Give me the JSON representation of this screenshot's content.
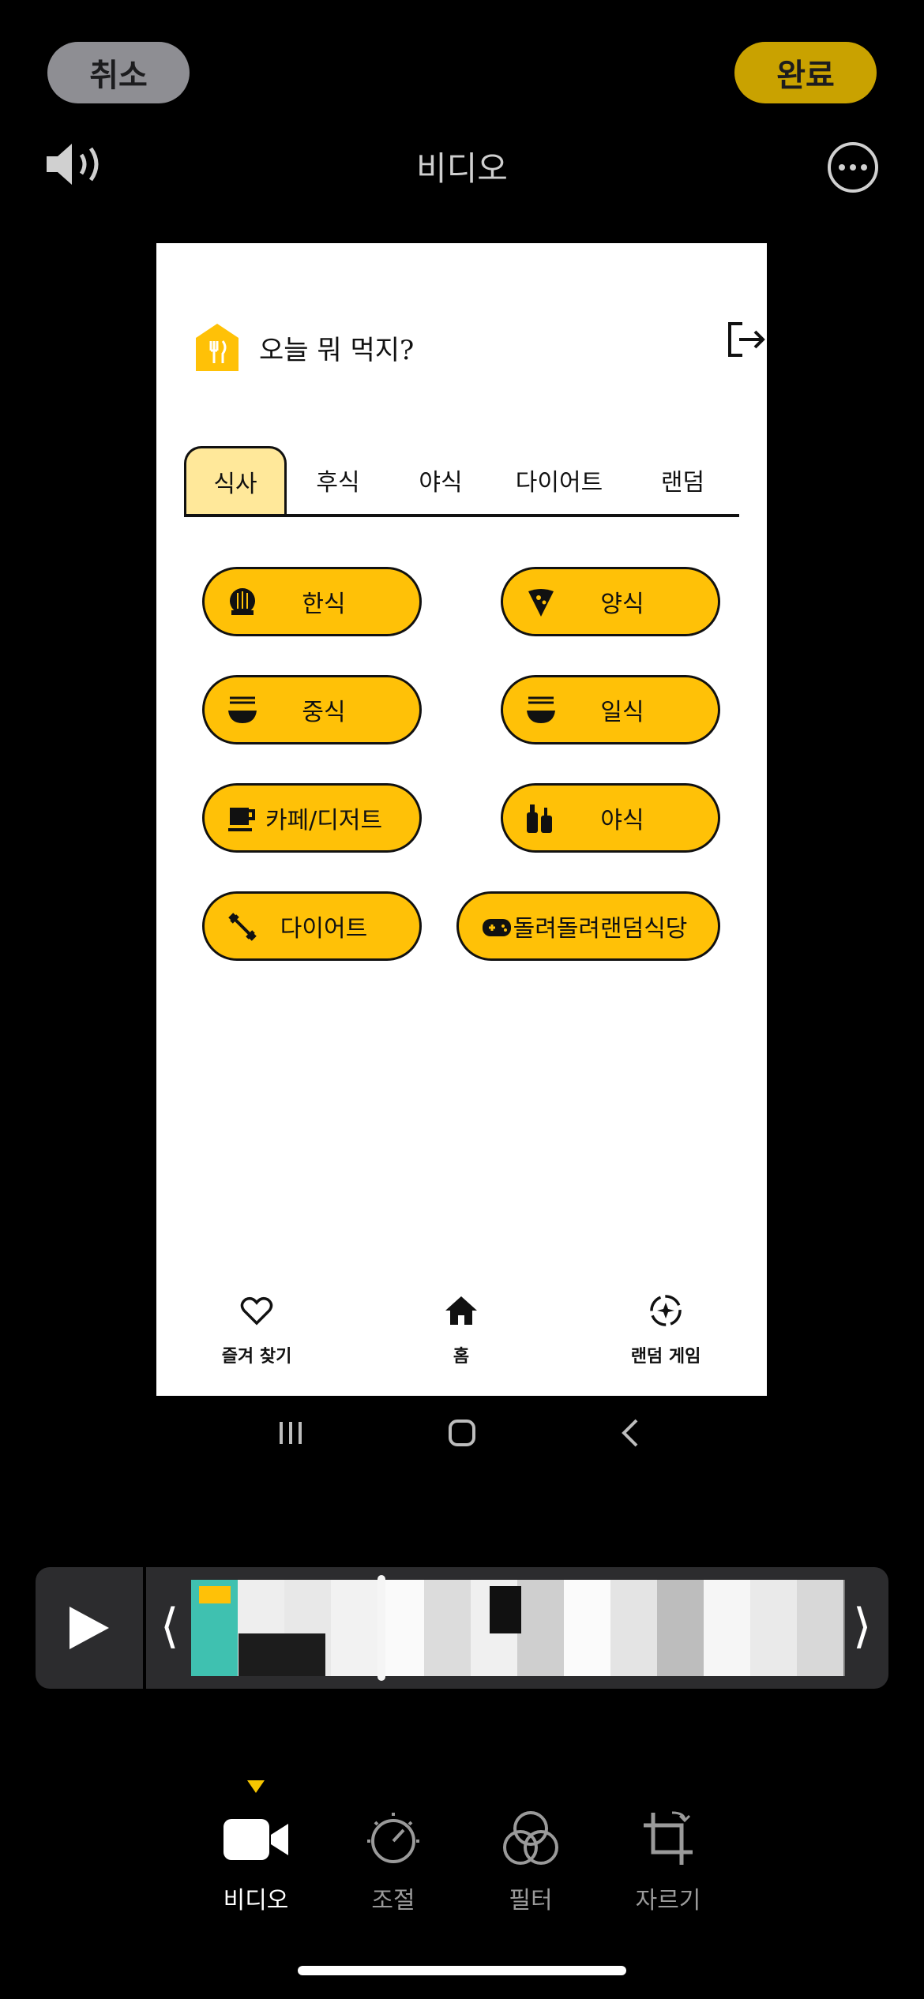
{
  "top_bar": {
    "cancel": "취소",
    "done": "완료",
    "title": "비디오"
  },
  "preview": {
    "app_title": "오늘 뭐 먹지?",
    "tabs": [
      {
        "label": "식사",
        "active": true
      },
      {
        "label": "후식",
        "active": false
      },
      {
        "label": "야식",
        "active": false
      },
      {
        "label": "다이어트",
        "active": false
      },
      {
        "label": "랜덤",
        "active": false
      }
    ],
    "categories": [
      {
        "label": "한식",
        "icon": "rice-bowl-icon"
      },
      {
        "label": "양식",
        "icon": "pizza-icon"
      },
      {
        "label": "중식",
        "icon": "noodle-bowl-icon"
      },
      {
        "label": "일식",
        "icon": "noodle-bowl-icon"
      },
      {
        "label": "카페/디저트",
        "icon": "coffee-cup-icon"
      },
      {
        "label": "야식",
        "icon": "bottles-icon"
      },
      {
        "label": "다이어트",
        "icon": "dumbbell-icon"
      },
      {
        "label": "돌려돌려랜덤식당",
        "icon": "gamepad-icon"
      }
    ],
    "bottom_nav": [
      {
        "label": "즐겨 찾기",
        "icon": "heart-icon"
      },
      {
        "label": "홈",
        "icon": "home-icon"
      },
      {
        "label": "랜덤 게임",
        "icon": "random-game-icon"
      }
    ],
    "accent_color": "#ffc107"
  },
  "toolbar": {
    "items": [
      {
        "label": "비디오",
        "icon": "video-camera-icon",
        "active": true
      },
      {
        "label": "조절",
        "icon": "adjust-dial-icon",
        "active": false
      },
      {
        "label": "필터",
        "icon": "filter-circles-icon",
        "active": false
      },
      {
        "label": "자르기",
        "icon": "crop-icon",
        "active": false
      }
    ]
  }
}
